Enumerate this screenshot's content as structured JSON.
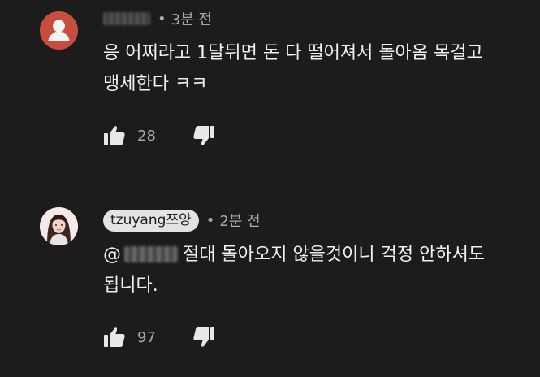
{
  "comments": [
    {
      "author_visible": "",
      "time": "3분 전",
      "text_line1": "응 어쩌라고 1달뒤면 돈 다 떨어져서 돌아옴 목걸고",
      "text_line2": "맹세한다 ㅋㅋ",
      "likes": "28",
      "avatar": "default-avatar-icon"
    },
    {
      "author": "tzuyang쯔양",
      "time": "2분 전",
      "mention_prefix": "@",
      "text_line1": "절대 돌아오지 않을것이니 걱정 안하셔도",
      "text_line2": "됩니다.",
      "likes": "97",
      "avatar": "profile-photo"
    }
  ],
  "colors": {
    "background": "#1c1c1c",
    "text": "#f1f1f1",
    "muted": "#aaaaaa",
    "default_avatar": "#c84d3e",
    "author_chip": "#e3e3e3"
  },
  "separator": "•"
}
